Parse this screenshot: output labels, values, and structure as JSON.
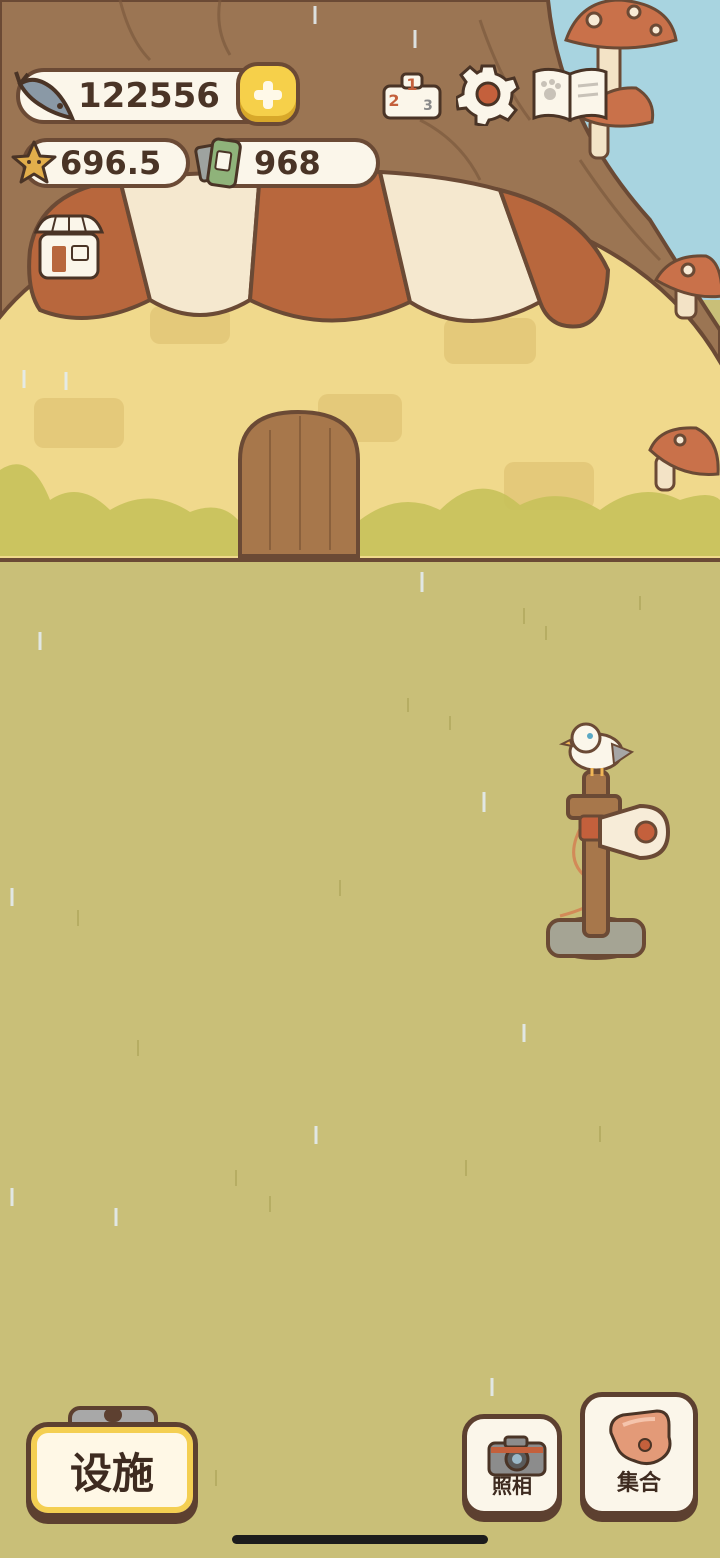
{
  "hud": {
    "fish_count": "122556",
    "star_value": "696.5",
    "cans_count": "968"
  },
  "top_icons": [
    "fish-icon",
    "plus-icon",
    "ranking-podium-icon",
    "gear-icon",
    "paw-book-icon",
    "star-icon",
    "canned-food-icon",
    "shop-icon"
  ],
  "bottom_bar": {
    "facility_label": "设施",
    "photo_label": "照相",
    "gather_label": "集合"
  },
  "podium_digits": [
    "2",
    "1",
    "3"
  ],
  "colors": {
    "grass": "#c9bf78",
    "tree_bark": "#9b7553",
    "sky": "#a8d4e0",
    "awning_brown": "#b8673d",
    "awning_cream": "#f5e8cf",
    "wall": "#f0d98c",
    "outline": "#6b4a35",
    "accent_yellow": "#f4cf52"
  }
}
